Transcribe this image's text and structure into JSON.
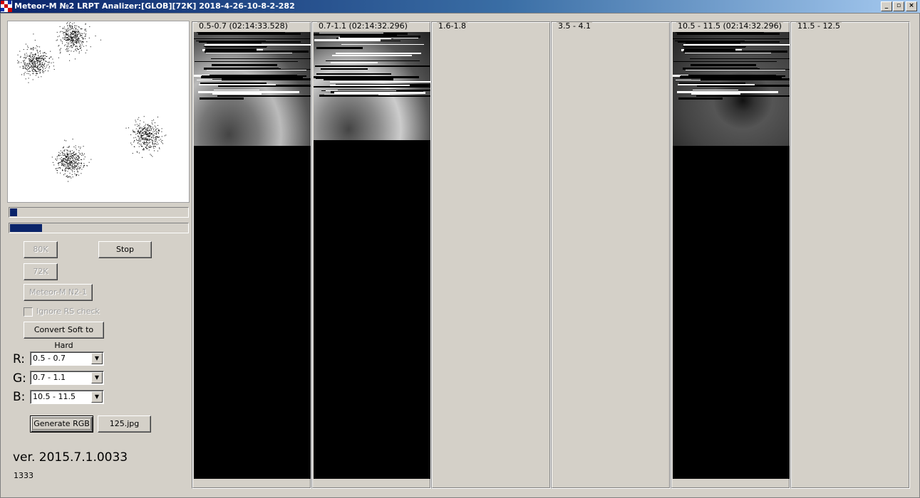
{
  "window": {
    "title": "Meteor-M №2 LRPT Analizer:[GLOB][72K] 2018-4-26-10-8-2-282",
    "minimize": "_",
    "maximize": "▫",
    "close": "×"
  },
  "progress": {
    "first_percent": 4,
    "second_percent": 18
  },
  "buttons": {
    "b80k": "80K",
    "b72k": "72K",
    "stop": "Stop",
    "meteor": "Meteor-M N2-1",
    "convert": "Convert Soft to Hard",
    "generate": "Generate RGB",
    "jpg": "125.jpg"
  },
  "checkbox": {
    "ignore_rs": "Ignore RS check"
  },
  "channels": {
    "r_label": "R:",
    "r_value": "0.5 - 0.7",
    "g_label": "G:",
    "g_value": "0.7 - 1.1",
    "b_label": "B:",
    "b_value": "10.5 - 11.5"
  },
  "version": "ver. 2015.7.1.0033",
  "counter": "1333",
  "panels": [
    {
      "title": "0.5-0.7 (02:14:33.528)",
      "has_image": true
    },
    {
      "title": "0.7-1.1 (02:14:32.296)",
      "has_image": true
    },
    {
      "title": "1.6-1.8",
      "has_image": false
    },
    {
      "title": "3.5 - 4.1",
      "has_image": false
    },
    {
      "title": "10.5 - 11.5 (02:14:32.296)",
      "has_image": true
    },
    {
      "title": "11.5 - 12.5",
      "has_image": false
    }
  ],
  "colors": {
    "title_active": "#0a246a",
    "face": "#d4d0c8",
    "progress_fill": "#0a246a"
  }
}
